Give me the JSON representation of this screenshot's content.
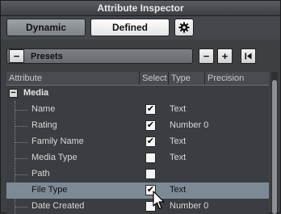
{
  "window": {
    "title": "Attribute Inspector"
  },
  "toolbar": {
    "dynamic_label": "Dynamic",
    "defined_label": "Defined",
    "settings_icon": "gear-icon"
  },
  "presets": {
    "label": "Presets",
    "minus": "−",
    "remove": "−",
    "add": "+",
    "skip": "⏮"
  },
  "table": {
    "columns": [
      "Attribute",
      "Select",
      "Type",
      "Precision"
    ],
    "group": {
      "name": "Media",
      "expander": "−"
    },
    "rows": [
      {
        "name": "Name",
        "selected": true,
        "type": "Text"
      },
      {
        "name": "Rating",
        "selected": true,
        "type": "Number 0"
      },
      {
        "name": "Family Name",
        "selected": true,
        "type": "Text"
      },
      {
        "name": "Media Type",
        "selected": false,
        "type": "Text"
      },
      {
        "name": "Path",
        "selected": false,
        "type": ""
      },
      {
        "name": "File Type",
        "selected": true,
        "type": "Text",
        "highlighted": true
      },
      {
        "name": "Date Created",
        "selected": false,
        "type": "Number 0"
      }
    ]
  },
  "colors": {
    "accent_selection": "#7d8a96",
    "background": "#3d4043"
  }
}
